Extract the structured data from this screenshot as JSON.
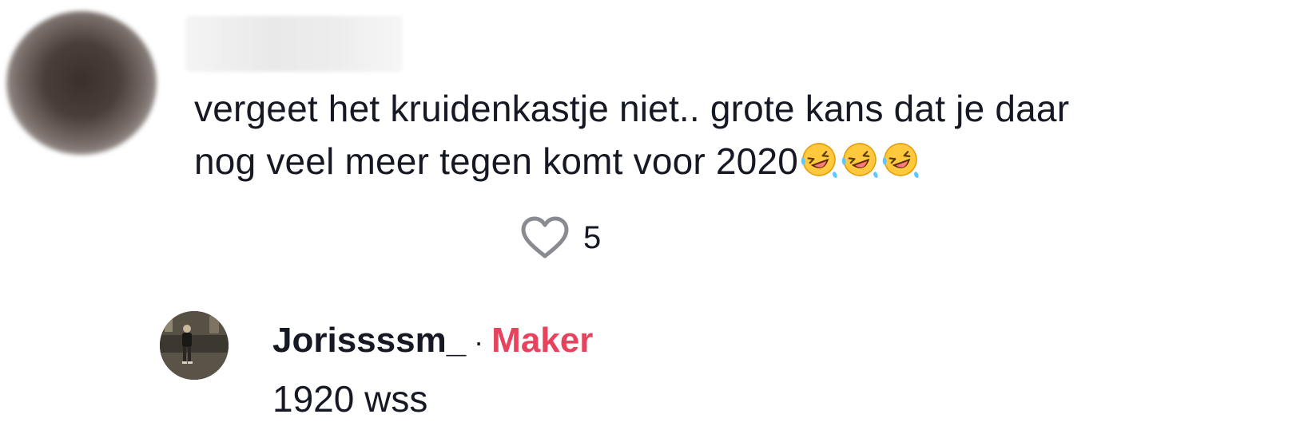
{
  "comment": {
    "author_hidden": true,
    "text_line1": "vergeet het kruidenkastje niet.. grote kans dat je daar",
    "text_line2": "nog veel meer tegen komt voor 2020",
    "emojis": [
      "rolling-on-floor-laughing",
      "rolling-on-floor-laughing",
      "rolling-on-floor-laughing"
    ],
    "like_count": "5"
  },
  "reply": {
    "username": "Jorissssm_",
    "separator": "·",
    "badge": "Maker",
    "text": "1920 wss"
  },
  "colors": {
    "text": "#161823",
    "badge": "#e8435e",
    "heart_outline": "#8a8b91"
  }
}
